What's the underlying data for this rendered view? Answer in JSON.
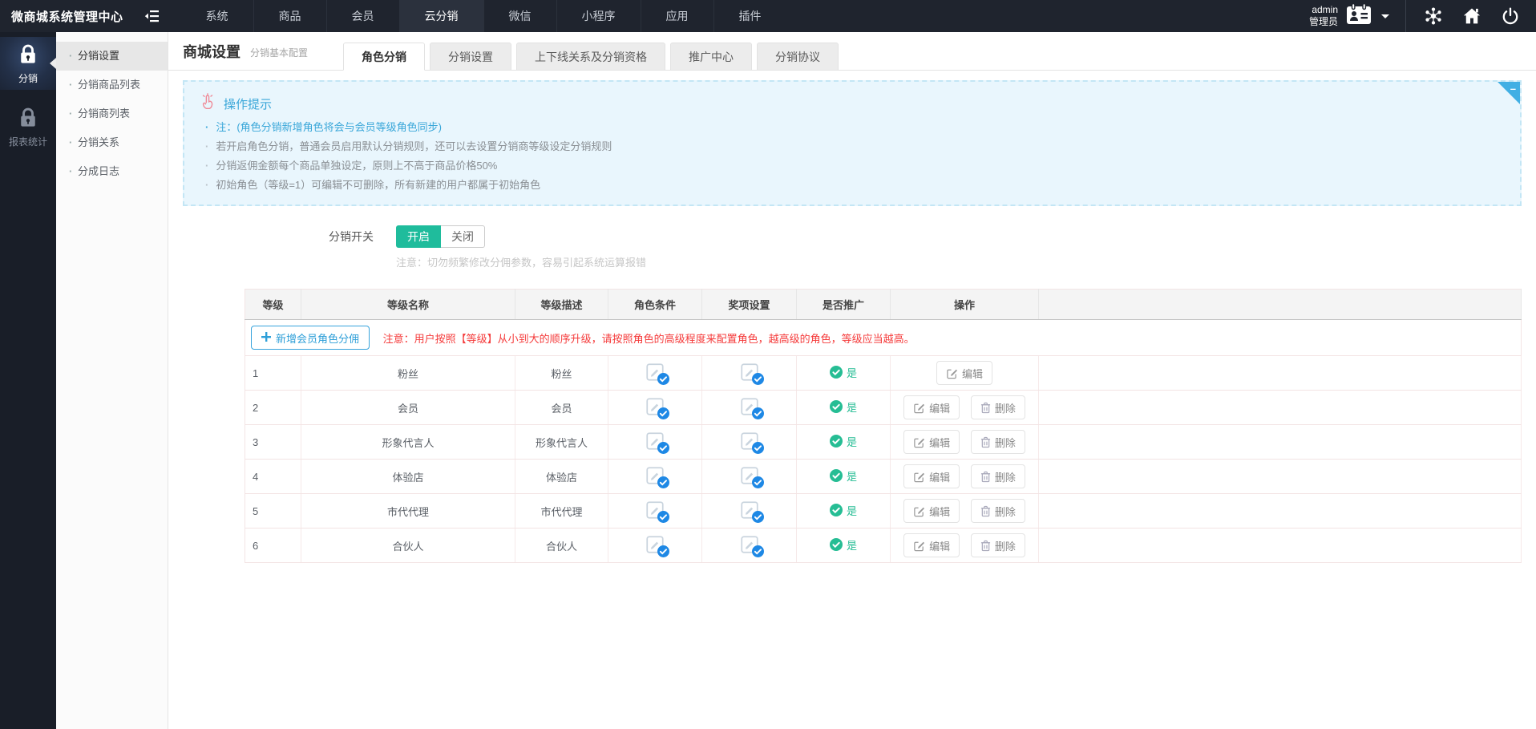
{
  "topbar": {
    "logo": "微商城系统管理中心",
    "nav": [
      {
        "label": "系统",
        "active": false
      },
      {
        "label": "商品",
        "active": false
      },
      {
        "label": "会员",
        "active": false
      },
      {
        "label": "云分销",
        "active": true
      },
      {
        "label": "微信",
        "active": false
      },
      {
        "label": "小程序",
        "active": false
      },
      {
        "label": "应用",
        "active": false
      },
      {
        "label": "插件",
        "active": false
      }
    ],
    "user": {
      "name": "admin",
      "role": "管理员"
    }
  },
  "rail": {
    "items": [
      {
        "label": "分销",
        "active": true
      },
      {
        "label": "报表统计",
        "active": false
      }
    ]
  },
  "sidebar": {
    "items": [
      {
        "label": "分销设置",
        "active": true
      },
      {
        "label": "分销商品列表",
        "active": false
      },
      {
        "label": "分销商列表",
        "active": false
      },
      {
        "label": "分销关系",
        "active": false
      },
      {
        "label": "分成日志",
        "active": false
      }
    ]
  },
  "page": {
    "title": "商城设置",
    "subtitle": "分销基本配置",
    "tabs": [
      {
        "label": "角色分销",
        "active": true
      },
      {
        "label": "分销设置",
        "active": false
      },
      {
        "label": "上下线关系及分销资格",
        "active": false
      },
      {
        "label": "推广中心",
        "active": false
      },
      {
        "label": "分销协议",
        "active": false
      }
    ]
  },
  "tips": {
    "title": "操作提示",
    "minimize": "–",
    "items": [
      {
        "text": "注：(角色分销新增角色将会与会员等级角色同步)",
        "active": true
      },
      {
        "text": "若开启角色分销，普通会员启用默认分销规则，还可以去设置分销商等级设定分销规则",
        "active": false
      },
      {
        "text": "分销返佣金额每个商品单独设定，原则上不高于商品价格50%",
        "active": false
      },
      {
        "text": "初始角色（等级=1）可编辑不可删除，所有新建的用户都属于初始角色",
        "active": false
      }
    ]
  },
  "switch": {
    "label": "分销开关",
    "on_label": "开启",
    "off_label": "关闭",
    "state": "on",
    "note": "注意：切勿频繁修改分佣参数，容易引起系统运算报错"
  },
  "table": {
    "add_button": "新增会员角色分佣",
    "warning": "注意：用户按照【等级】从小到大的顺序升级，请按照角色的高级程度来配置角色，越高级的角色，等级应当越高。",
    "headers": [
      "等级",
      "等级名称",
      "等级描述",
      "角色条件",
      "奖项设置",
      "是否推广",
      "操作"
    ],
    "edit_label": "编辑",
    "delete_label": "删除",
    "rows": [
      {
        "level": "1",
        "name": "粉丝",
        "desc": "粉丝",
        "promote": "是",
        "can_delete": false
      },
      {
        "level": "2",
        "name": "会员",
        "desc": "会员",
        "promote": "是",
        "can_delete": true
      },
      {
        "level": "3",
        "name": "形象代言人",
        "desc": "形象代言人",
        "promote": "是",
        "can_delete": true
      },
      {
        "level": "4",
        "name": "体验店",
        "desc": "体验店",
        "promote": "是",
        "can_delete": true
      },
      {
        "level": "5",
        "name": "市代代理",
        "desc": "市代代理",
        "promote": "是",
        "can_delete": true
      },
      {
        "level": "6",
        "name": "合伙人",
        "desc": "合伙人",
        "promote": "是",
        "can_delete": true
      }
    ]
  },
  "icons": {
    "collapse-sidebar-icon": "bars-with-left-arrow",
    "id-card-icon": "id-badge",
    "share-icon": "connected-dots-network",
    "home-icon": "house-with-chimney",
    "power-icon": "power-symbol",
    "lock-icon": "padlock",
    "hand-pointer-icon": "clicking-hand",
    "config-check-icon": "edit-square-with-blue-check-badge",
    "yes-check-icon": "green-circle-check",
    "edit-icon": "pencil-square",
    "delete-icon": "trash-can",
    "plus-icon": "plus"
  },
  "colors": {
    "topbar_bg": "#1f242e",
    "accent_blue": "#36a3dc",
    "info_bg": "#e9f6fd",
    "green_on": "#1fbc9c",
    "status_green": "#26bd94",
    "badge_blue": "#1e88e5",
    "warning_red": "#f53b3b"
  }
}
